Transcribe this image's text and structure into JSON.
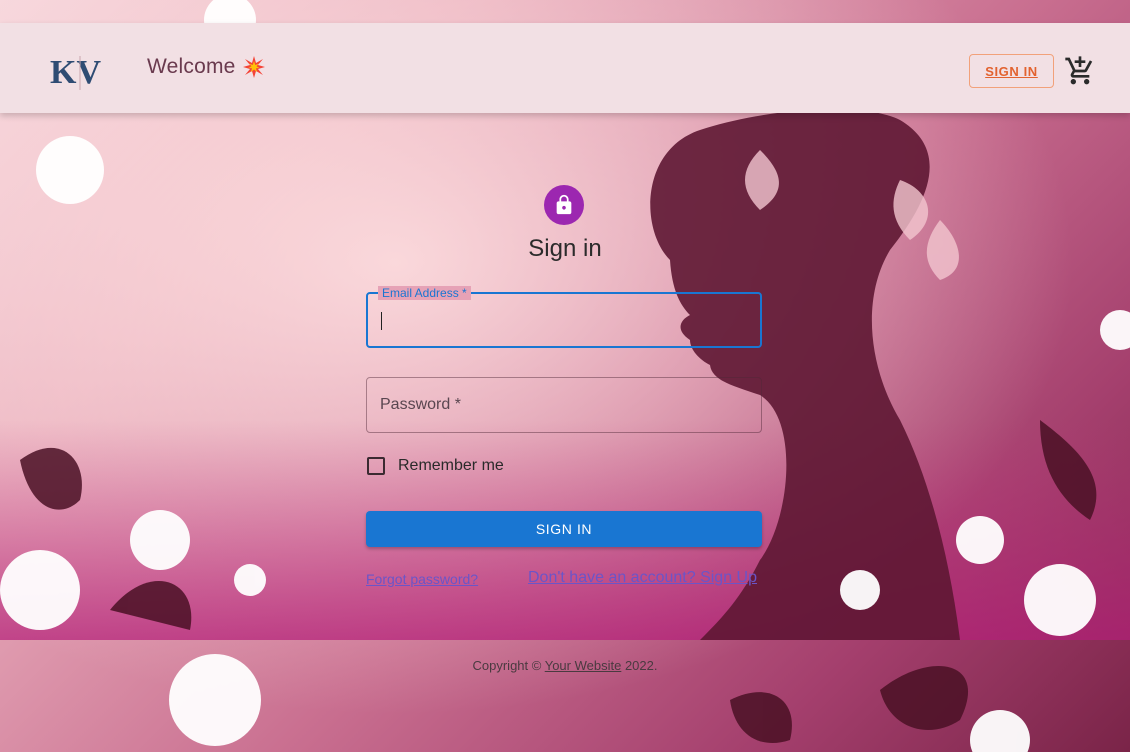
{
  "header": {
    "logo_text": "KV",
    "welcome": "Welcome",
    "sign_in_label": "SIGN IN"
  },
  "form": {
    "title": "Sign in",
    "email": {
      "label": "Email Address *",
      "value": ""
    },
    "password": {
      "label": "Password *",
      "value": ""
    },
    "remember_label": "Remember me",
    "submit_label": "SIGN IN",
    "forgot_label": "Forgot password?",
    "signup_label": "Don't have an account? Sign Up"
  },
  "footer": {
    "copyright_prefix": "Copyright ©",
    "site_link": "Your Website",
    "year_suffix": "2022."
  },
  "icons": {
    "logo": "kv-logo",
    "welcome_emoji": "collision-emoji",
    "cart": "add-shopping-cart-icon",
    "lock": "lock-icon"
  },
  "colors": {
    "header_bg": "#f2e0e4",
    "primary": "#1976d2",
    "avatar": "#9c27b0",
    "accent_orange": "#e2622f",
    "link": "#6b55c8"
  }
}
